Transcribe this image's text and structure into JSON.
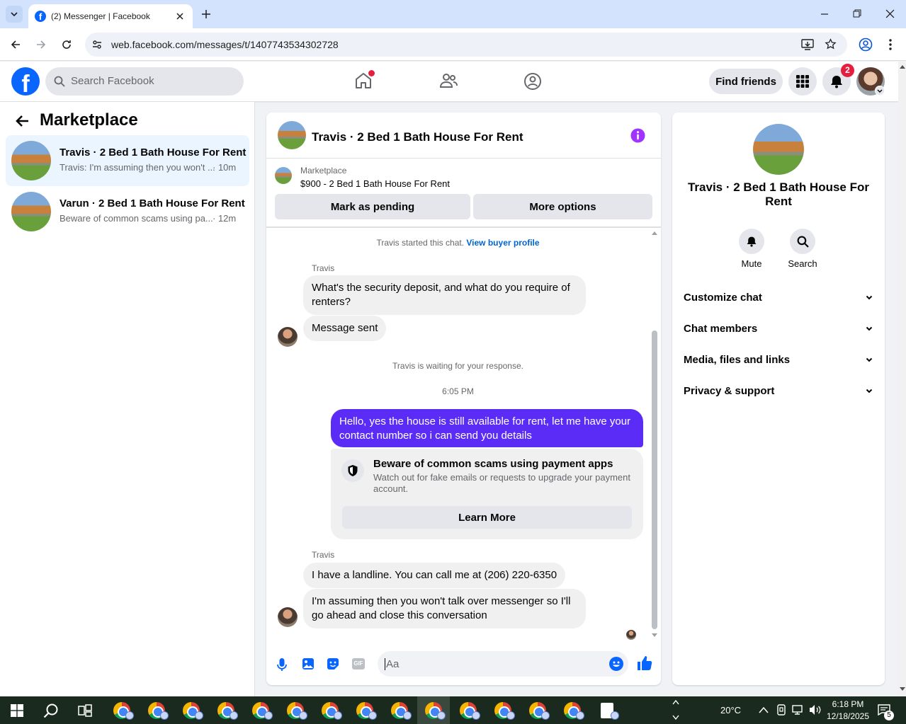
{
  "browser": {
    "tab_title": "(2) Messenger | Facebook",
    "url": "web.facebook.com/messages/t/1407743534302728"
  },
  "fb_header": {
    "search_placeholder": "Search Facebook",
    "find_friends": "Find friends",
    "notification_count": "2"
  },
  "sidebar": {
    "title": "Marketplace",
    "threads": [
      {
        "title": "Travis · 2 Bed 1 Bath House For Rent",
        "preview": "Travis: I'm assuming then you won't ...",
        "time": "· 10m"
      },
      {
        "title": "Varun · 2 Bed 1 Bath House For Rent",
        "preview": "Beware of common scams using pa...",
        "time": "· 12m"
      }
    ]
  },
  "chat": {
    "header_title": "Travis · 2 Bed 1 Bath House For Rent",
    "listing_label": "Marketplace",
    "listing_title": "$900 - 2 Bed 1 Bath House For Rent",
    "mark_pending": "Mark as pending",
    "more_options": "More options",
    "started_text": "Travis started this chat.",
    "view_buyer": "View buyer profile",
    "sender_name_1": "Travis",
    "msg_1": "What's the security deposit, and what do you require of renters?",
    "msg_2": "Message sent",
    "waiting_text": "Travis is waiting for your response.",
    "timestamp": "6:05 PM",
    "my_msg": "Hello, yes the house is still available for rent, let me have your contact number so i can send you  details",
    "scam_title": "Beware of common scams using payment apps",
    "scam_body": "Watch out for fake emails or requests to upgrade your payment account.",
    "learn_more": "Learn More",
    "sender_name_2": "Travis",
    "msg_3": "I have a landline. You can call me at (206) 220-6350",
    "msg_4": "I'm assuming then you won't talk over messenger so I'll go ahead and close this conversation",
    "composer_placeholder": "Aa"
  },
  "info_panel": {
    "title": "Travis · 2 Bed 1 Bath House For Rent",
    "mute": "Mute",
    "search": "Search",
    "sections": [
      "Customize chat",
      "Chat members",
      "Media, files and links",
      "Privacy & support"
    ]
  },
  "taskbar": {
    "weather": "20°C",
    "time": "6:18 PM",
    "date": "12/18/2025",
    "notif_count": "5"
  },
  "colors": {
    "fb_blue": "#0866ff",
    "my_bubble": "#5b2cf5",
    "link": "#0064d1",
    "badge_red": "#e41e3f",
    "info_purple": "#a033ff"
  }
}
